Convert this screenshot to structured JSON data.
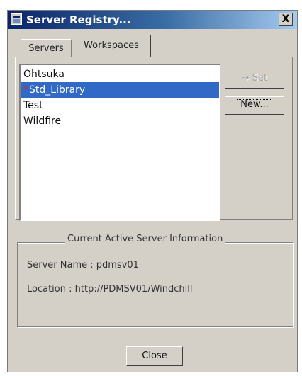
{
  "window": {
    "title": "Server Registry...",
    "close_glyph": "X"
  },
  "tabs": [
    {
      "label": "Servers",
      "active": false
    },
    {
      "label": "Workspaces",
      "active": true
    }
  ],
  "list": {
    "items": [
      {
        "label": "Ohtsuka",
        "selected": false
      },
      {
        "label": "Std_Library",
        "selected": true,
        "marker": "*"
      },
      {
        "label": "Test",
        "selected": false
      },
      {
        "label": "Wildfire",
        "selected": false
      }
    ]
  },
  "buttons": {
    "set_arrow": "→",
    "set_label": "Set",
    "new_label": "New...",
    "close_label": "Close"
  },
  "server_info": {
    "group_title": "Current Active Server Information",
    "server_name": "Server Name : pdmsv01",
    "location": "Location : http://PDMSV01/Windchill"
  },
  "colors": {
    "selection": "#3169c6",
    "title_bar": "#0a246a",
    "marker": "#e8232a"
  }
}
